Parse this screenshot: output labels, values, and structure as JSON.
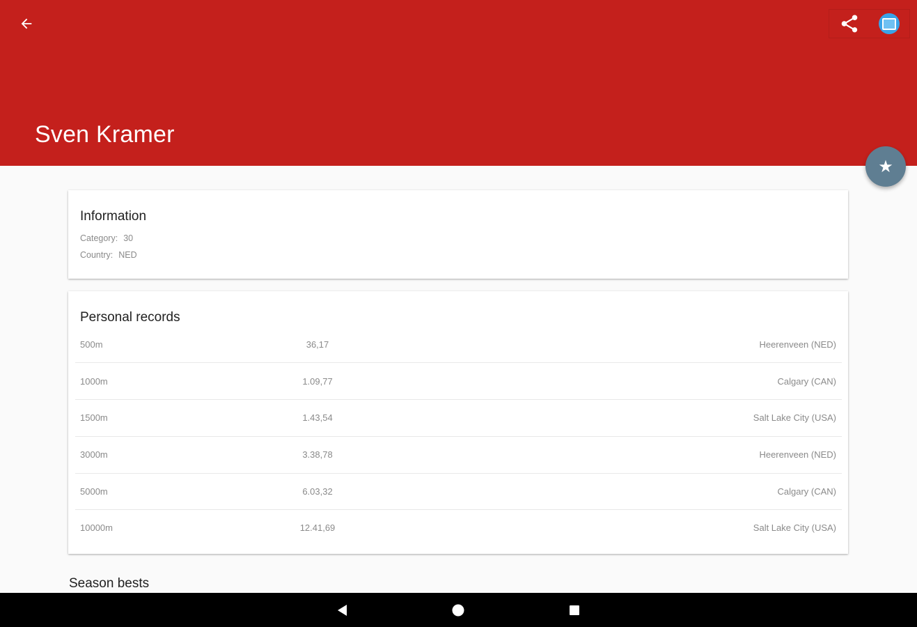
{
  "colors": {
    "header_bg": "#c4201c",
    "fab_bg": "#5f7e92",
    "cast_blue": "#3aa3e8"
  },
  "header": {
    "title": "Sven Kramer",
    "back_icon": "arrow-left-icon",
    "share_icon": "share-icon",
    "cast_icon": "cast-icon"
  },
  "fab": {
    "icon": "star-icon",
    "glyph": "★"
  },
  "information": {
    "title": "Information",
    "category_label": "Category:",
    "category_value": "30",
    "country_label": "Country:",
    "country_value": "NED"
  },
  "personal_records": {
    "title": "Personal records",
    "rows": [
      {
        "distance": "500m",
        "time": "36,17",
        "location": "Heerenveen (NED)"
      },
      {
        "distance": "1000m",
        "time": "1.09,77",
        "location": "Calgary (CAN)"
      },
      {
        "distance": "1500m",
        "time": "1.43,54",
        "location": "Salt Lake City (USA)"
      },
      {
        "distance": "3000m",
        "time": "3.38,78",
        "location": "Heerenveen (NED)"
      },
      {
        "distance": "5000m",
        "time": "6.03,32",
        "location": "Calgary (CAN)"
      },
      {
        "distance": "10000m",
        "time": "12.41,69",
        "location": "Salt Lake City (USA)"
      }
    ]
  },
  "season_bests": {
    "title": "Season bests"
  },
  "navbar": {
    "back_icon": "nav-back-icon",
    "home_icon": "nav-home-icon",
    "recents_icon": "nav-recents-icon"
  }
}
